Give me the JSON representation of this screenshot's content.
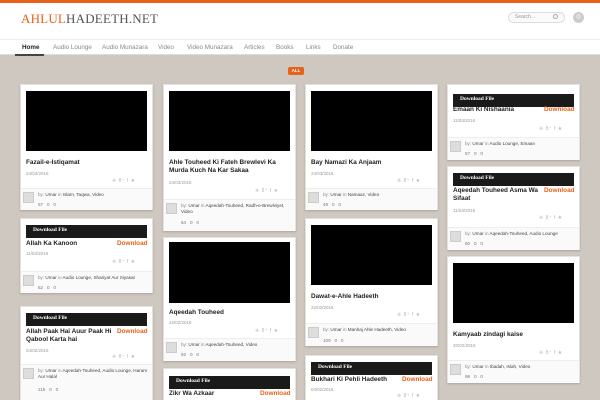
{
  "site": {
    "logo_a": "AHLUL",
    "logo_b": "HADEETH.NET",
    "search_placeholder": "Search...",
    "rss": "◎"
  },
  "nav": [
    "Home",
    "Audio Lounge",
    "Audio Munazara",
    "Video",
    "Video Munazara",
    "Articles",
    "Books",
    "Links",
    "Donate"
  ],
  "filter": "ALL",
  "icons": {
    "share": "❈ 8⁺ f ★"
  },
  "download_bar": "Download File",
  "download_label": "Download",
  "by": "by:",
  "in": "in",
  "cards": [
    {
      "title": "Fazail-e-Istiqamat",
      "date": "24/03/2016",
      "user": "Umar",
      "cats": "Islam, Taqwa, Video",
      "views": "57",
      "comments": "0",
      "likes": "0"
    },
    {
      "title": "Allah Ka Kanoon",
      "date": "11/03/2016",
      "user": "Umar",
      "cats": "Audio Lounge, Shariyat Aur Siyasat",
      "views": "52",
      "comments": "0",
      "likes": "0"
    },
    {
      "title": "Allah Paak Hai Auur Paak Hi Qabool Karta hai",
      "date": "04/02/2016",
      "user": "Umar",
      "cats": "Aqeedah-Touheed, Audio Lounge, Haram Aur Halal",
      "views": "115",
      "comments": "0",
      "likes": "0"
    },
    {
      "title": "Ahle Touheed Ki Fateh Brewlevi Ka Murda Kuch Na Kar Sakaa",
      "date": "24/03/2016",
      "user": "Umar",
      "cats": "Aqeedah-Touheed, Radh-e-Brewlviyet, Video",
      "views": "64",
      "comments": "0",
      "likes": "0"
    },
    {
      "title": "Aqeedah Touheed",
      "date": "22/02/2016",
      "user": "Umar",
      "cats": "Aqeedah-Touheed, Video",
      "views": "92",
      "comments": "0",
      "likes": "0"
    },
    {
      "title": "Zikr Wa Azkaar"
    },
    {
      "title": "Bay Namazi Ka Anjaam",
      "date": "24/03/2016",
      "user": "Umar",
      "cats": "Namaaz, Video",
      "views": "49",
      "comments": "0",
      "likes": "0"
    },
    {
      "title": "Dawat-e-Ahle Hadeeth",
      "date": "22/02/2016",
      "user": "Umar",
      "cats": "Manhaj Ahle Hadeeth, Video",
      "views": "109",
      "comments": "0",
      "likes": "0"
    },
    {
      "title": "Bukhari Ki Pehli Hadeeth",
      "date": "04/02/2016"
    },
    {
      "title": "Emaan Ki Nishaania",
      "date": "11/03/2016",
      "user": "Umar",
      "cats": "Audio Lounge, Emaan",
      "views": "57",
      "comments": "0",
      "likes": "0"
    },
    {
      "title": "Aqeedah Touheed Asma Wa Sifaat",
      "date": "11/03/2016",
      "user": "Umar",
      "cats": "Aqeedah-Touheed, Audio Lounge",
      "views": "60",
      "comments": "0",
      "likes": "0"
    },
    {
      "title": "Kamyaab zindagi kaise",
      "date": "20/02/2016",
      "user": "Umar",
      "cats": "Ibadah, Islah, Video",
      "views": "96",
      "comments": "0",
      "likes": "0"
    }
  ]
}
